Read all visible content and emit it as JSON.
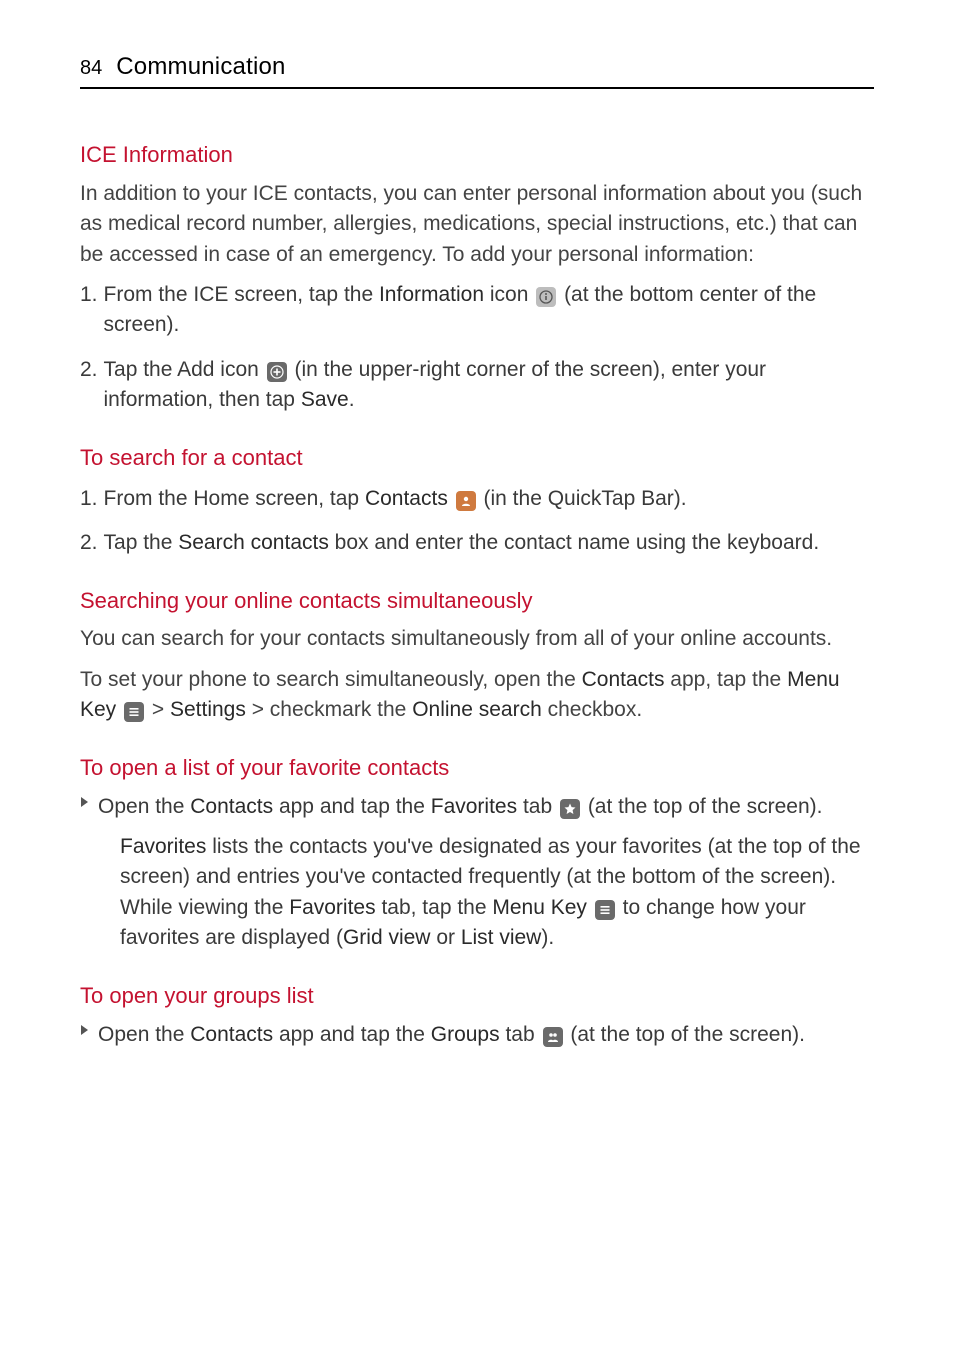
{
  "header": {
    "page_number": "84",
    "section": "Communication"
  },
  "sections": {
    "ice_info": {
      "heading": "ICE Information",
      "intro": "In addition to your ICE contacts, you can enter personal information about you (such as medical record number, allergies, medications, special instructions, etc.) that can be accessed in case of an emergency.  To add your personal information:",
      "step1": {
        "num": "1.",
        "pre": " From the ICE screen, tap the ",
        "bold1": "Information",
        "mid": " icon ",
        "post": " (at the bottom center of the screen)."
      },
      "step2": {
        "num": "2.",
        "pre": " Tap the Add icon ",
        "mid": " (in the upper-right corner of the screen), enter your information, then tap ",
        "bold1": "Save",
        "end": "."
      }
    },
    "search": {
      "heading": "To search for a contact",
      "step1": {
        "num": "1.",
        "pre": " From the Home screen, tap ",
        "bold1": "Contacts",
        "post": " (in the QuickTap Bar)."
      },
      "step2": {
        "num": "2.",
        "pre": " Tap the ",
        "bold1": "Search contacts",
        "post": " box and enter the contact name using the keyboard."
      }
    },
    "online": {
      "heading": "Searching your online contacts simultaneously",
      "p1": "You can search for your contacts simultaneously from all of your online accounts.",
      "p2": {
        "pre": "To set your phone to search simultaneously, open the ",
        "bold1": "Contacts",
        "mid1": " app, tap the ",
        "bold2": "Menu Key",
        "mid2": " > ",
        "bold3": "Settings",
        "mid3": " > checkmark the ",
        "bold4": "Online search",
        "end": " checkbox."
      }
    },
    "favorites": {
      "heading": "To open a list of your favorite contacts",
      "bullet": {
        "pre": " Open the ",
        "bold1": "Contacts",
        "mid1": " app and tap the ",
        "bold2": "Favorites",
        "mid2": " tab ",
        "end": " (at the top of the screen)."
      },
      "sub": {
        "bold1": "Favorites",
        "t1": " lists the contacts you've designated as your favorites (at the top of the screen) and entries you've contacted frequently (at the bottom of the screen). While viewing the ",
        "bold2": "Favorites",
        "t2": " tab, tap the ",
        "bold3": "Menu Key",
        "t3": " to change how your favorites are displayed (",
        "bold4": "Grid view",
        "t4": " or ",
        "bold5": "List view",
        "t5": ")."
      }
    },
    "groups": {
      "heading": "To open your groups list",
      "bullet": {
        "pre": " Open the ",
        "bold1": "Contacts",
        "mid1": " app and tap the ",
        "bold2": "Groups",
        "mid2": " tab ",
        "end": " (at the top of the screen)."
      }
    }
  }
}
